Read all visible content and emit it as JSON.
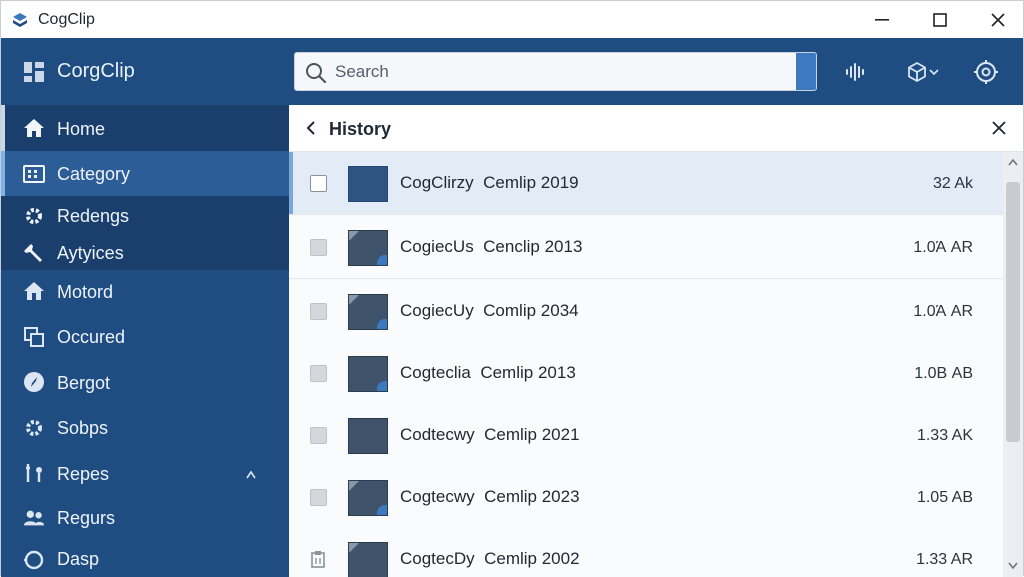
{
  "window": {
    "title": "CogClip",
    "minimize_icon": "minimize-icon",
    "maximize_icon": "maximize-icon",
    "close_icon": "close-icon"
  },
  "header": {
    "brand": "CorgClip",
    "search": {
      "placeholder": "Search",
      "value": ""
    },
    "icons": [
      "waveform-icon",
      "cube-icon",
      "settings-icon"
    ]
  },
  "sidebar": {
    "items": [
      {
        "label": "Home",
        "icon": "home-icon"
      },
      {
        "label": "Category",
        "icon": "category-icon"
      },
      {
        "label": "Redengs",
        "icon": "gear-icon"
      },
      {
        "label": "Aytyices",
        "icon": "wrench-icon"
      },
      {
        "label": "Motord",
        "icon": "house-icon"
      },
      {
        "label": "Occured",
        "icon": "copy-icon"
      },
      {
        "label": "Bergot",
        "icon": "compass-icon"
      },
      {
        "label": "Sobps",
        "icon": "gear-icon"
      },
      {
        "label": "Repes",
        "icon": "tools-icon"
      },
      {
        "label": "Regurs",
        "icon": "users-icon"
      },
      {
        "label": "Dasp",
        "icon": "circle-icon"
      }
    ]
  },
  "panel": {
    "title": "History",
    "rows": [
      {
        "name": "CogClirzy",
        "label": "Cemlip 2019",
        "size": "32 Ak"
      },
      {
        "name": "CogiecUs",
        "label": "Cenclip 2013",
        "size": "1.0Ά AR"
      },
      {
        "name": "CogiecUy",
        "label": "Comlip 2034",
        "size": "1.0Ά AR"
      },
      {
        "name": "Cogteclia",
        "label": "Cemlip 2013",
        "size": "1.0Β AB"
      },
      {
        "name": "Codtecwy",
        "label": "Cemlip 2021",
        "size": "1.33 AK"
      },
      {
        "name": "Cogtecwy",
        "label": "Cemlip 2023",
        "size": "1.05 AB"
      },
      {
        "name": "CogtecDy",
        "label": "Cemlip 2002",
        "size": "1.33 AR"
      }
    ]
  },
  "colors": {
    "header_bg": "#1f4d82",
    "sidebar_bg": "#1f4d82",
    "sidebar_active": "#2c5d97",
    "accent": "#3c79bf",
    "row_selected": "#e2ebf6"
  }
}
